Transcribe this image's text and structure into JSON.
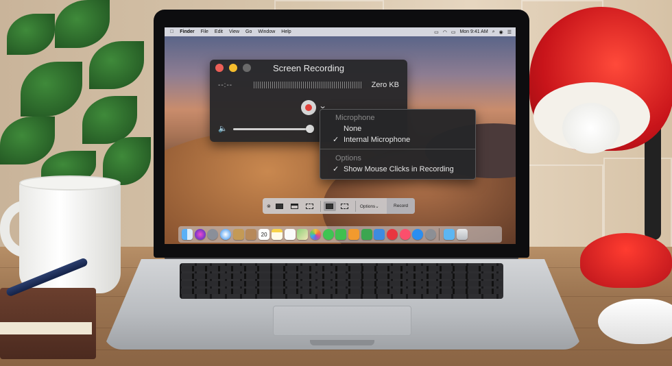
{
  "menubar": {
    "apple_icon": "apple-icon",
    "items": [
      "Finder",
      "File",
      "Edit",
      "View",
      "Go",
      "Window",
      "Help"
    ],
    "clock": "Mon 9:41 AM"
  },
  "recording_window": {
    "title": "Screen Recording",
    "elapsed": "--:--",
    "file_size": "Zero KB",
    "colors": {
      "close": "#ec5f57",
      "minimize": "#f5bd2d",
      "zoom": "#6a6a6a",
      "record_dot": "#e0413a"
    }
  },
  "dropdown": {
    "microphone_header": "Microphone",
    "mic_none": "None",
    "mic_internal": "Internal Microphone",
    "check": "✓",
    "options_header": "Options",
    "show_clicks": "Show Mouse Clicks in Recording",
    "volume_level": 0.88
  },
  "capture_bar": {
    "options_label": "Options",
    "options_chevron": "⌄",
    "record_label": "Record"
  },
  "dock": {
    "calendar_day": "20",
    "apps": [
      "finder-icon",
      "siri-icon",
      "launchpad-icon",
      "safari-icon",
      "mail-icon",
      "contacts-icon",
      "calendar-icon",
      "notes-icon",
      "reminders-icon",
      "maps-icon",
      "photos-icon",
      "messages-icon",
      "facetime-icon",
      "pages-icon",
      "numbers-icon",
      "keynote-icon",
      "news-icon",
      "music-icon",
      "app-store-icon",
      "system-preferences-icon",
      "downloads-folder-icon",
      "trash-icon"
    ]
  }
}
